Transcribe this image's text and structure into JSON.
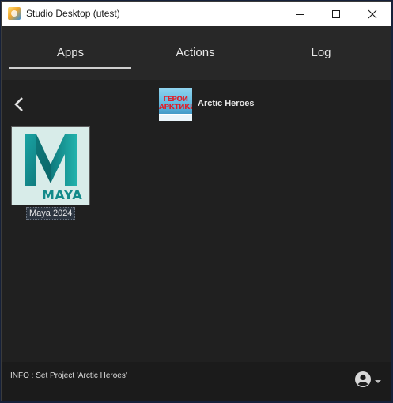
{
  "window": {
    "title": "Studio Desktop (utest)",
    "icons": {
      "app": "studio-desktop-icon",
      "minimize": "minimize-icon",
      "maximize": "maximize-icon",
      "close": "close-icon"
    }
  },
  "tabs": [
    {
      "label": "Apps",
      "selected": true
    },
    {
      "label": "Actions",
      "selected": false
    },
    {
      "label": "Log",
      "selected": false
    }
  ],
  "project": {
    "name": "Arctic Heroes",
    "thumbnail_text": [
      "ГЕРОИ",
      "АРКТИКИ"
    ]
  },
  "apps": [
    {
      "label": "Maya 2024",
      "logo_text": "MAYA",
      "icon": "maya-icon"
    }
  ],
  "status": {
    "message": "INFO :  Set Project 'Arctic Heroes'"
  },
  "colors": {
    "background": "#202020",
    "tab_bar": "#282828",
    "status_bar": "#1b1b1b",
    "text": "#e8e8e8",
    "maya_teal": "#138a8a"
  }
}
